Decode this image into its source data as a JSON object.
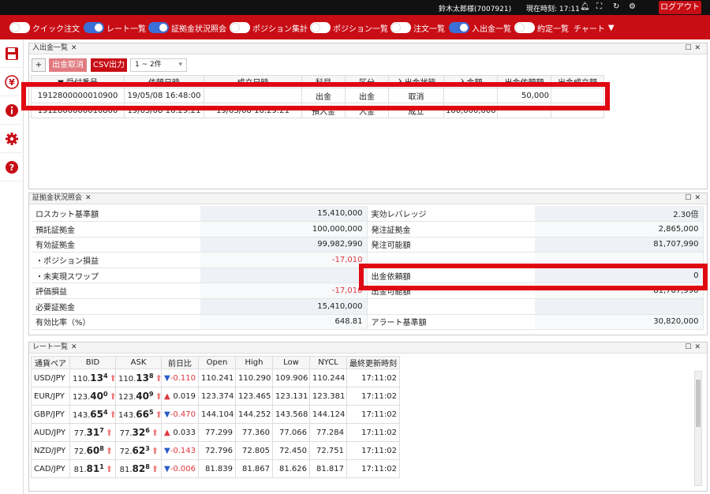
{
  "topbar": {
    "user": "鈴木太郎様(7007921)",
    "time_label": "現在時刻: 17:11",
    "logout": "ログアウト"
  },
  "toolbar": {
    "items": [
      {
        "label": "クイック注文",
        "on": false
      },
      {
        "label": "レート一覧",
        "on": true
      },
      {
        "label": "証拠金状況照会",
        "on": true
      },
      {
        "label": "ポジション集計",
        "on": false
      },
      {
        "label": "ポジション一覧",
        "on": false
      },
      {
        "label": "注文一覧",
        "on": false
      },
      {
        "label": "入出金一覧",
        "on": true
      },
      {
        "label": "約定一覧",
        "on": false
      }
    ],
    "chart": "チャート"
  },
  "deposits": {
    "tab": "入出金一覧",
    "add": "+",
    "cancel": "出金取消",
    "csv": "CSV出力",
    "range": "1 ~ 2件",
    "columns": [
      "▼ 受付番号",
      "依頼日時",
      "成立日時",
      "科目",
      "区分",
      "入出金状態",
      "入金額",
      "出金依頼額",
      "出金成立額"
    ],
    "rows": [
      [
        "1912800000010900",
        "19/05/08 16:48:00",
        "",
        "出金",
        "出金",
        "取消",
        "",
        "50,000",
        ""
      ],
      [
        "1912800000010800",
        "19/05/08 16:29:21",
        "19/05/08 16:29:21",
        "預入金",
        "入金",
        "成立",
        "100,000,000",
        "",
        ""
      ]
    ]
  },
  "margin": {
    "tab": "証拠金状況照会",
    "rows": [
      {
        "l1": "ロスカット基準額",
        "v1": "15,410,000",
        "l2": "実効レバレッジ",
        "v2": "2.30倍"
      },
      {
        "l1": "預託証拠金",
        "v1": "100,000,000",
        "l2": "発注証拠金",
        "v2": "2,865,000"
      },
      {
        "l1": "有効証拠金",
        "v1": "99,982,990",
        "l2": "発注可能額",
        "v2": "81,707,990"
      },
      {
        "l1": "・ポジション損益",
        "v1": "-17,010",
        "l2": "",
        "v2": ""
      },
      {
        "l1": "・未実現スワップ",
        "v1": "",
        "l2": "出金依頼額",
        "v2": "0"
      },
      {
        "l1": "評価損益",
        "v1": "-17,010",
        "l2": "出金可能額",
        "v2": "81,707,990"
      },
      {
        "l1": "必要証拠金",
        "v1": "15,410,000",
        "l2": "",
        "v2": ""
      },
      {
        "l1": "有効比率（%）",
        "v1": "648.81",
        "l2": "アラート基準額",
        "v2": "30,820,000"
      }
    ]
  },
  "rates": {
    "tab": "レート一覧",
    "columns": [
      "通貨ペア",
      "BID",
      "ASK",
      "前日比",
      "Open",
      "High",
      "Low",
      "NYCL",
      "最終更新時刻"
    ],
    "rows": [
      {
        "pair": "USD/JPY",
        "bid_a": "110.",
        "bid_b": "13",
        "bid_c": "4",
        "ask_a": "110.",
        "ask_b": "13",
        "ask_c": "8",
        "dir": "down",
        "chg": "-0.110",
        "open": "110.241",
        "high": "110.290",
        "low": "109.906",
        "nycl": "110.244",
        "time": "17:11:02"
      },
      {
        "pair": "EUR/JPY",
        "bid_a": "123.",
        "bid_b": "40",
        "bid_c": "0",
        "ask_a": "123.",
        "ask_b": "40",
        "ask_c": "9",
        "dir": "up",
        "chg": "0.019",
        "open": "123.374",
        "high": "123.465",
        "low": "123.131",
        "nycl": "123.381",
        "time": "17:11:02"
      },
      {
        "pair": "GBP/JPY",
        "bid_a": "143.",
        "bid_b": "65",
        "bid_c": "4",
        "ask_a": "143.",
        "ask_b": "66",
        "ask_c": "5",
        "dir": "down",
        "chg": "-0.470",
        "open": "144.104",
        "high": "144.252",
        "low": "143.568",
        "nycl": "144.124",
        "time": "17:11:02"
      },
      {
        "pair": "AUD/JPY",
        "bid_a": "77.",
        "bid_b": "31",
        "bid_c": "7",
        "ask_a": "77.",
        "ask_b": "32",
        "ask_c": "6",
        "dir": "up",
        "chg": "0.033",
        "open": "77.299",
        "high": "77.360",
        "low": "77.066",
        "nycl": "77.284",
        "time": "17:11:02"
      },
      {
        "pair": "NZD/JPY",
        "bid_a": "72.",
        "bid_b": "60",
        "bid_c": "8",
        "ask_a": "72.",
        "ask_b": "62",
        "ask_c": "3",
        "dir": "down",
        "chg": "-0.143",
        "open": "72.796",
        "high": "72.805",
        "low": "72.450",
        "nycl": "72.751",
        "time": "17:11:02"
      },
      {
        "pair": "CAD/JPY",
        "bid_a": "81.",
        "bid_b": "81",
        "bid_c": "1",
        "ask_a": "81.",
        "ask_b": "82",
        "ask_c": "8",
        "dir": "down",
        "chg": "-0.006",
        "open": "81.839",
        "high": "81.867",
        "low": "81.626",
        "nycl": "81.817",
        "time": "17:11:02"
      }
    ]
  },
  "colors": {
    "brand": "#c80d15",
    "highlight": "#e00812",
    "toggle_on": "#3a6fd8",
    "negative": "#e0353d"
  }
}
